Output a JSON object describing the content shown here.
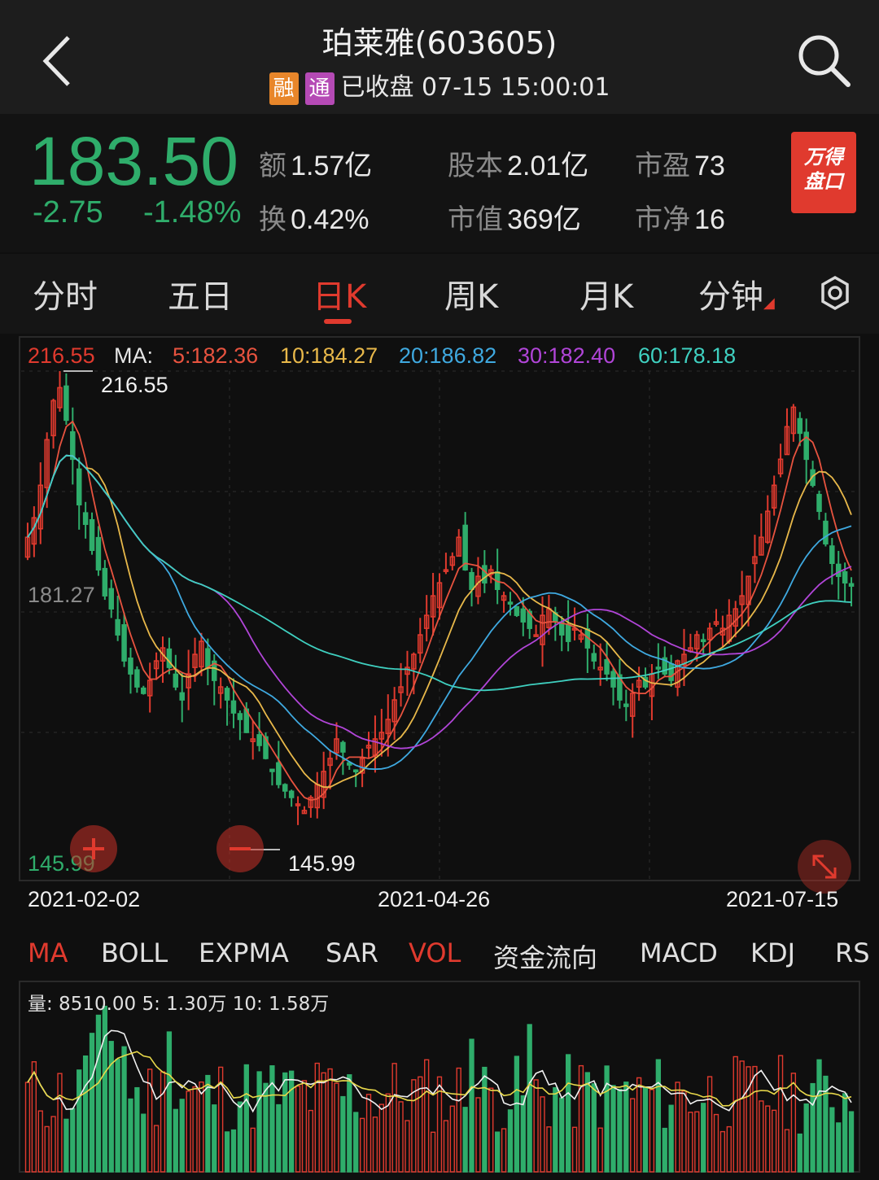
{
  "header": {
    "title": "珀莱雅(603605)",
    "tag_rong": "融",
    "tag_tong": "通",
    "status": "已收盘 07-15 15:00:01"
  },
  "quote": {
    "price": "183.50",
    "change": "-2.75",
    "change_pct": "-1.48%",
    "stats": [
      {
        "label": "额",
        "value": "1.57亿"
      },
      {
        "label": "换",
        "value": "0.42%"
      },
      {
        "label": "股本",
        "value": "2.01亿"
      },
      {
        "label": "市值",
        "value": "369亿"
      },
      {
        "label": "市盈",
        "value": "73"
      },
      {
        "label": "市净",
        "value": "16"
      }
    ],
    "wind_button": [
      "万得",
      "盘口"
    ]
  },
  "tabs": {
    "items": [
      "分时",
      "五日",
      "日K",
      "周K",
      "月K",
      "分钟"
    ],
    "active": "日K"
  },
  "chart_legend": {
    "high_label": "216.55",
    "ma_label": "MA:",
    "ma5": "5:182.36",
    "ma10": "10:184.27",
    "ma20": "20:186.82",
    "ma30": "30:182.40",
    "ma60": "60:178.18",
    "max_marker": "216.55",
    "mid_level": "181.27",
    "low_label": "145.99",
    "min_marker": "145.99"
  },
  "x_axis": [
    "2021-02-02",
    "2021-04-26",
    "2021-07-15"
  ],
  "indicators": {
    "items": [
      "MA",
      "BOLL",
      "EXPMA",
      "SAR",
      "VOL",
      "资金流向",
      "MACD",
      "KDJ",
      "RS"
    ],
    "active": [
      "MA",
      "VOL"
    ]
  },
  "volume_legend": "量: 8510.00  5: 1.30万  10: 1.58万",
  "colors": {
    "up": "#e03a2e",
    "down": "#2fad6b",
    "ma5": "#e8533f",
    "ma10": "#e8b84a",
    "ma20": "#3fa9e0",
    "ma30": "#b145d8",
    "ma60": "#3fd0c0"
  },
  "chart_data": {
    "type": "candlestick",
    "price_range": [
      145.99,
      216.55
    ],
    "x_range": [
      "2021-02-02",
      "2021-07-15"
    ],
    "last_close": 183.5,
    "ma": {
      "ma5": 182.36,
      "ma10": 184.27,
      "ma20": 186.82,
      "ma30": 182.4,
      "ma60": 178.18
    },
    "volume": {
      "last": 8510.0,
      "ma5": 13000,
      "ma10": 15800
    },
    "close_series": [
      191,
      194,
      199,
      206,
      212,
      214,
      209,
      203,
      196,
      193,
      189,
      186,
      182,
      180,
      176,
      172,
      170,
      168,
      167,
      169,
      172,
      174,
      171,
      168,
      166,
      170,
      173,
      175,
      171,
      169,
      168,
      166,
      164,
      163,
      161,
      160,
      159,
      157,
      155,
      153,
      152,
      151,
      150,
      149,
      151,
      153,
      155,
      157,
      160,
      158,
      156,
      155,
      157,
      159,
      160,
      161,
      163,
      166,
      168,
      171,
      173,
      176,
      179,
      182,
      184,
      186,
      188,
      191,
      186,
      183,
      185,
      184,
      186,
      183,
      182,
      181,
      179,
      178,
      177,
      176,
      179,
      180,
      178,
      176,
      175,
      177,
      176,
      174,
      172,
      171,
      170,
      168,
      166,
      165,
      167,
      169,
      168,
      170,
      171,
      170,
      169,
      172,
      173,
      174,
      176,
      175,
      177,
      178,
      177,
      179,
      180,
      182,
      185,
      188,
      191,
      195,
      199,
      203,
      208,
      211,
      207,
      203,
      199,
      195,
      190,
      187,
      185,
      184,
      183.5
    ]
  }
}
